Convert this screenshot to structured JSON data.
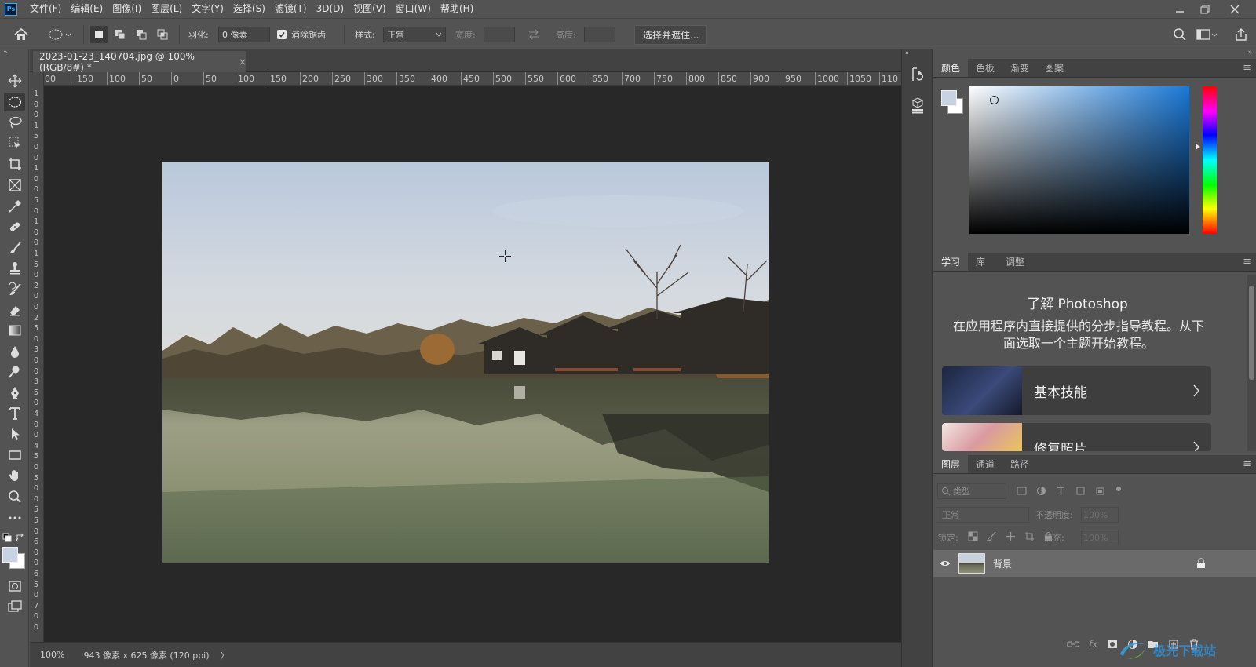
{
  "menubar": {
    "app_logo": "Ps",
    "items": [
      "文件(F)",
      "编辑(E)",
      "图像(I)",
      "图层(L)",
      "文字(Y)",
      "选择(S)",
      "滤镜(T)",
      "3D(D)",
      "视图(V)",
      "窗口(W)",
      "帮助(H)"
    ]
  },
  "options": {
    "feather_label": "羽化:",
    "feather_value": "0 像素",
    "antialias_label": "消除锯齿",
    "antialias_checked": true,
    "style_label": "样式:",
    "style_value": "正常",
    "width_label": "宽度:",
    "height_label": "高度:",
    "select_mask_button": "选择并遮住..."
  },
  "document": {
    "tab_title": "2023-01-23_140704.jpg @ 100%(RGB/8#) *",
    "ruler_h_labels": [
      "00",
      "150",
      "100",
      "50",
      "0",
      "50",
      "100",
      "150",
      "200",
      "250",
      "300",
      "350",
      "400",
      "450",
      "500",
      "550",
      "600",
      "650",
      "700",
      "750",
      "800",
      "850",
      "900",
      "950",
      "1000",
      "1050",
      "110"
    ],
    "ruler_v_labels": [
      "1",
      "0",
      "0",
      "1",
      "5",
      "0",
      "0",
      "1",
      "0",
      "0",
      "5",
      "0",
      "1",
      "0",
      "0",
      "1",
      "5",
      "0",
      "2",
      "0",
      "0",
      "2",
      "5",
      "0",
      "3",
      "0",
      "0",
      "3",
      "5",
      "0",
      "4",
      "0",
      "0",
      "4",
      "5",
      "0",
      "5",
      "0",
      "0",
      "5",
      "5",
      "0",
      "6",
      "0",
      "0",
      "6",
      "5",
      "0",
      "7",
      "0",
      "0"
    ]
  },
  "status": {
    "zoom": "100%",
    "dimensions": "943 像素 x 625 像素 (120 ppi)",
    "arrow": "〉"
  },
  "color_panel": {
    "tabs": [
      "颜色",
      "色板",
      "渐变",
      "图案"
    ],
    "foreground": "#c7d3e3",
    "background": "#ffffff",
    "hue_color": "#1a78d6"
  },
  "learn_panel": {
    "tabs": [
      "学习",
      "库",
      "调整"
    ],
    "title": "了解 Photoshop",
    "description": "在应用程序内直接提供的分步指导教程。从下面选取一个主题开始教程。",
    "cards": [
      {
        "label": "基本技能"
      },
      {
        "label": "修复照片"
      }
    ]
  },
  "layers_panel": {
    "tabs": [
      "图层",
      "通道",
      "路径"
    ],
    "filter_label": "类型",
    "blend_mode": "正常",
    "opacity_label": "不透明度:",
    "opacity_value": "100%",
    "lock_label": "锁定:",
    "fill_label": "填充:",
    "fill_value": "100%",
    "layers": [
      {
        "name": "背景",
        "visible": true,
        "locked": true
      }
    ]
  },
  "watermark": {
    "text": "极光下载站"
  }
}
